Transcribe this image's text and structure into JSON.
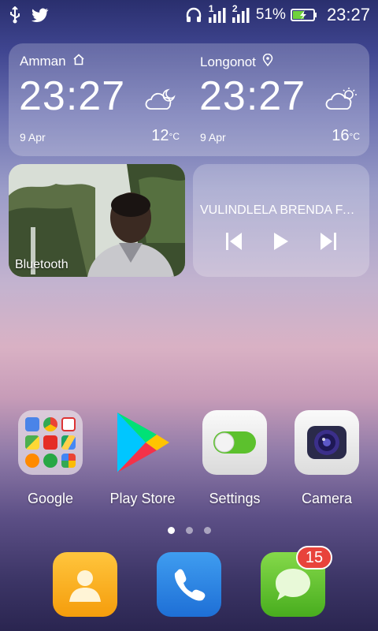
{
  "status_bar": {
    "battery_percent": "51%",
    "time": "23:27",
    "sim1_label": "1",
    "sim2_label": "2"
  },
  "weather_widget": {
    "left": {
      "city": "Amman",
      "city_icon": "home-icon",
      "time": "23:27",
      "date": "9 Apr",
      "temp": "12",
      "unit": "°C",
      "condition_icon": "cloudy-night-icon"
    },
    "right": {
      "city": "Longonot",
      "city_icon": "location-pin-icon",
      "time": "23:27",
      "date": "9 Apr",
      "temp": "16",
      "unit": "°C",
      "condition_icon": "partly-cloudy-day-icon"
    }
  },
  "photo_widget": {
    "caption": "Bluetooth"
  },
  "music_widget": {
    "song_title": "VULINDLELA BRENDA FASSIE"
  },
  "apps": [
    {
      "label": "Google"
    },
    {
      "label": "Play Store"
    },
    {
      "label": "Settings"
    },
    {
      "label": "Camera"
    }
  ],
  "page_indicator": {
    "total": 3,
    "current": 1
  },
  "dock": {
    "messages_badge": "15"
  },
  "colors": {
    "accent_badge": "#e8433b",
    "contacts": "#f5a524",
    "phone": "#2a84e6",
    "messages": "#5cc22f"
  }
}
